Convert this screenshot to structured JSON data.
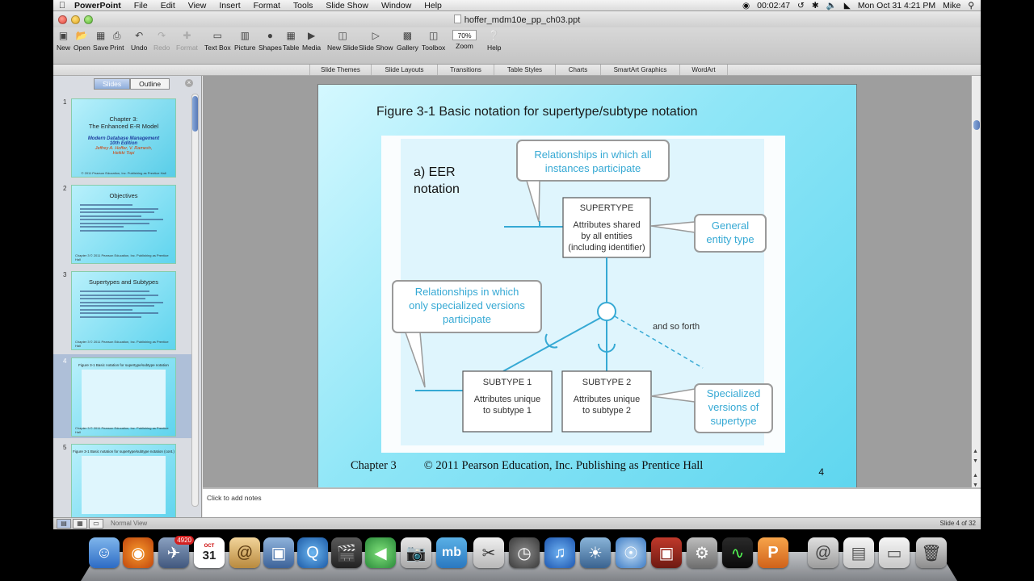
{
  "menubar": {
    "app": "PowerPoint",
    "menus": [
      "File",
      "Edit",
      "View",
      "Insert",
      "Format",
      "Tools",
      "Slide Show",
      "Window",
      "Help"
    ],
    "timer": "00:02:47",
    "clock": "Mon Oct 31  4:21 PM",
    "user": "Mike"
  },
  "window": {
    "title": "hoffer_mdm10e_pp_ch03.ppt"
  },
  "toolbar": {
    "new": "New",
    "open": "Open",
    "save": "Save",
    "print": "Print",
    "undo": "Undo",
    "redo": "Redo",
    "format": "Format",
    "text_box": "Text Box",
    "picture": "Picture",
    "shapes": "Shapes",
    "table": "Table",
    "media": "Media",
    "new_slide": "New Slide",
    "slide_show": "Slide Show",
    "gallery": "Gallery",
    "toolbox": "Toolbox",
    "zoom_value": "70%",
    "zoom": "Zoom",
    "help": "Help"
  },
  "ribbon": [
    "Slide Themes",
    "Slide Layouts",
    "Transitions",
    "Table Styles",
    "Charts",
    "SmartArt Graphics",
    "WordArt"
  ],
  "pane": {
    "tab_slides": "Slides",
    "tab_outline": "Outline",
    "thumbs": [
      {
        "num": "1",
        "title": "Chapter 3:\nThe Enhanced E-R Model",
        "sub": "Modern Database Management\n10th Edition",
        "red": "Jeffrey A. Hoffer, V. Ramesh,\nHeikki Topi",
        "foot": "© 2011 Pearson Education, Inc.  Publishing as Prentice Hall"
      },
      {
        "num": "2",
        "title": "Objectives",
        "foot": "Chapter 3      © 2011 Pearson Education, Inc.  Publishing as Prentice Hall"
      },
      {
        "num": "3",
        "title": "Supertypes and Subtypes",
        "foot": "Chapter 3      © 2011 Pearson Education, Inc.  Publishing as Prentice Hall"
      },
      {
        "num": "4",
        "title": "Figure 3-1 Basic notation for supertype/subtype notation",
        "foot": "Chapter 3      © 2011 Pearson Education, Inc.  Publishing as Prentice Hall"
      },
      {
        "num": "5",
        "title": "Figure 3-1 Basic notation for supertype/subtype notation (cont.)",
        "foot": "Chapter 3      © 2011 Pearson Education, Inc.  Publishing as Prentice Hall"
      }
    ]
  },
  "slide": {
    "title": "Figure 3-1 Basic notation for supertype/subtype notation",
    "footer_chapter": "Chapter 3",
    "footer_copy": "© 2011 Pearson Education, Inc.  Publishing as Prentice Hall",
    "number": "4",
    "figure": {
      "label_line1": "a) EER",
      "label_line2": "notation",
      "callout_top_1": "Relationships in which all",
      "callout_top_2": "instances participate",
      "supertype": "SUPERTYPE",
      "super_attr_1": "Attributes shared",
      "super_attr_2": "by all entities",
      "super_attr_3": "(including identifier)",
      "general_1": "General",
      "general_2": "entity type",
      "callout_left_1": "Relationships in which",
      "callout_left_2": "only specialized versions",
      "callout_left_3": "participate",
      "and_so_forth": "and so forth",
      "subtype1": "SUBTYPE 1",
      "sub1_attr_1": "Attributes unique",
      "sub1_attr_2": "to subtype 1",
      "subtype2": "SUBTYPE 2",
      "sub2_attr_1": "Attributes unique",
      "sub2_attr_2": "to subtype 2",
      "special_1": "Specialized",
      "special_2": "versions of",
      "special_3": "supertype"
    }
  },
  "notes": {
    "placeholder": "Click to add notes"
  },
  "status": {
    "view": "Normal View",
    "position": "Slide 4 of 32"
  },
  "dock": {
    "badge": "4920",
    "calendar_month": "OCT",
    "calendar_day": "31"
  },
  "colors": {
    "accent": "#2aa7d0",
    "slide_bg": "#8fe6f7",
    "callout_text": "#36a9d4"
  }
}
